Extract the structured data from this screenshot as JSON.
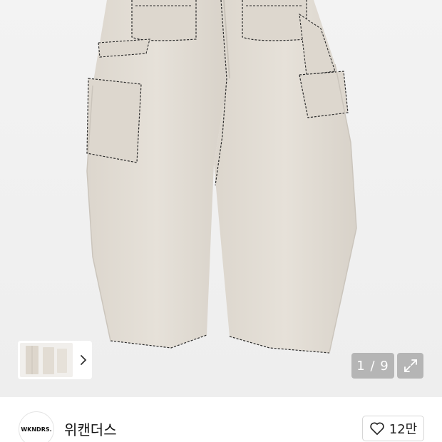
{
  "gallery": {
    "page_counter": "1 / 9",
    "expand_icon": "expand-icon",
    "thumbnail_arrow_icon": "chevron-right-icon"
  },
  "seller": {
    "avatar_text": "WKNDRS.",
    "name": "위캔더스"
  },
  "like": {
    "icon": "heart-outline-icon",
    "count": "12만"
  },
  "colors": {
    "pants": "#e2ddd5",
    "stitching": "#2a2a2a",
    "overlay": "#aaaaaa"
  }
}
